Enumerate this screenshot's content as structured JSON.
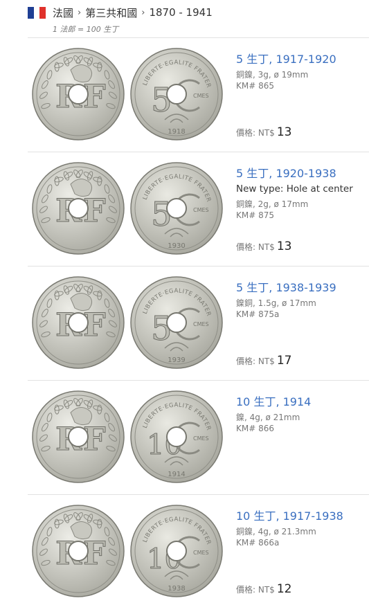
{
  "breadcrumb": {
    "country": "法國",
    "period": "第三共和國",
    "years": "1870 - 1941",
    "separator": "›",
    "flag_colors": [
      "#1f3f94",
      "#ffffff",
      "#e0312b"
    ]
  },
  "subtitle": "1 法郎 = 100 生丁",
  "price_label": "價格: NT$",
  "coins": [
    {
      "title": "5 生丁, 1917-1920",
      "note": "",
      "composition": "銅鎳, 3g, ø 19mm",
      "km": "KM# 865",
      "price": "13",
      "denom": "5",
      "year": "1918"
    },
    {
      "title": "5 生丁, 1920-1938",
      "note": "New type: Hole at center",
      "composition": "銅鎳, 2g, ø 17mm",
      "km": "KM# 875",
      "price": "13",
      "denom": "5",
      "year": "1930"
    },
    {
      "title": "5 生丁, 1938-1939",
      "note": "",
      "composition": "鎳銅, 1.5g, ø 17mm",
      "km": "KM# 875a",
      "price": "17",
      "denom": "5",
      "year": "1939"
    },
    {
      "title": "10 生丁, 1914",
      "note": "",
      "composition": "鎳, 4g, ø 21mm",
      "km": "KM# 866",
      "price": "",
      "denom": "10",
      "year": "1914"
    },
    {
      "title": "10 生丁, 1917-1938",
      "note": "",
      "composition": "銅鎳, 4g, ø 21.3mm",
      "km": "KM# 866a",
      "price": "12",
      "denom": "10",
      "year": "1938"
    }
  ],
  "coin_art": {
    "obverse_letters": [
      "R",
      "F"
    ],
    "reverse_legend": "LIBERTE·EGALITE FRATERNITE",
    "reverse_unit": "CMES"
  }
}
